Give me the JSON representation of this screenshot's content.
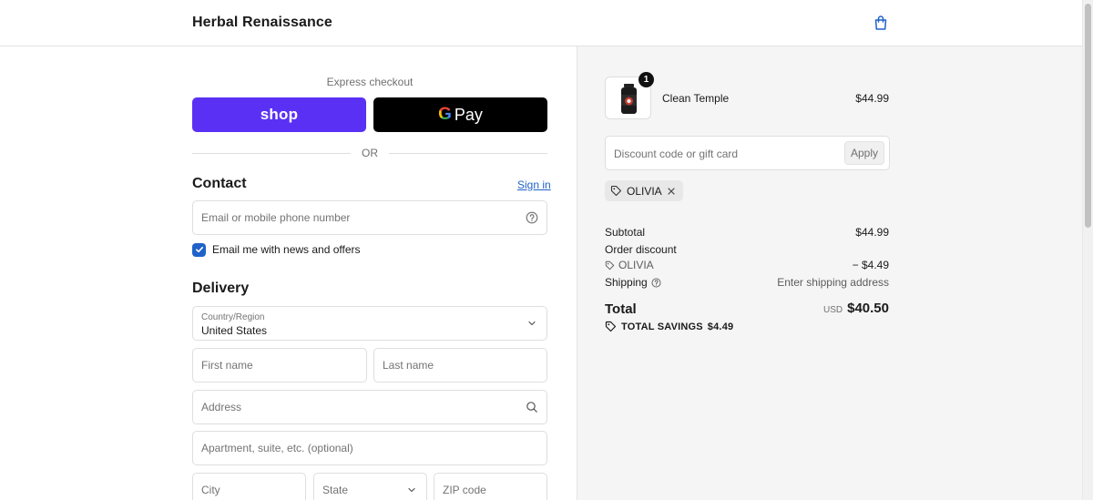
{
  "header": {
    "brand": "Herbal Renaissance",
    "cart_icon": "shopping-bag-icon"
  },
  "express": {
    "label": "Express checkout",
    "shop_label": "shop",
    "gpay_g": "G",
    "gpay_label": "Pay",
    "or_label": "OR"
  },
  "contact": {
    "title": "Contact",
    "signin_label": "Sign in",
    "email_placeholder": "Email or mobile phone number",
    "newsletter_label": "Email me with news and offers",
    "newsletter_checked": true
  },
  "delivery": {
    "title": "Delivery",
    "country_label": "Country/Region",
    "country_value": "United States",
    "first_name_placeholder": "First name",
    "last_name_placeholder": "Last name",
    "address_placeholder": "Address",
    "apartment_placeholder": "Apartment, suite, etc. (optional)",
    "city_placeholder": "City",
    "state_placeholder": "State",
    "zip_placeholder": "ZIP code"
  },
  "order": {
    "item": {
      "name": "Clean Temple",
      "price": "$44.99",
      "quantity": "1"
    },
    "discount_placeholder": "Discount code or gift card",
    "apply_label": "Apply",
    "applied_code": "OLIVIA",
    "subtotal_label": "Subtotal",
    "subtotal_value": "$44.99",
    "order_discount_label": "Order discount",
    "discount_code_label": "OLIVIA",
    "discount_value": "− $4.49",
    "shipping_label": "Shipping",
    "shipping_value": "Enter shipping address",
    "total_label": "Total",
    "total_currency": "USD",
    "total_value": "$40.50",
    "savings_label": "TOTAL SAVINGS",
    "savings_value": "$4.49"
  },
  "colors": {
    "shop_purple": "#5a31f4",
    "link_blue": "#1f62c9",
    "right_pane_bg": "#f5f5f5"
  }
}
